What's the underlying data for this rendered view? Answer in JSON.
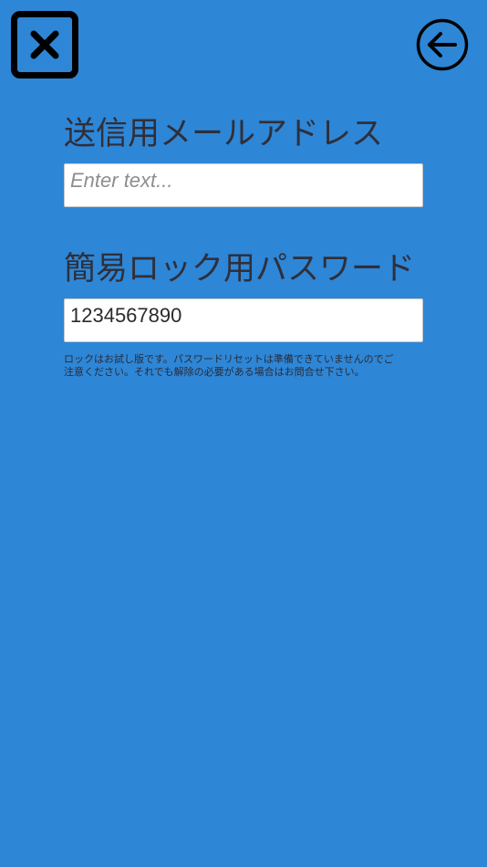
{
  "header": {
    "close_icon": "close-x-icon",
    "back_icon": "arrow-left-circle-icon"
  },
  "email_section": {
    "label": "送信用メールアドレス",
    "placeholder": "Enter text...",
    "value": ""
  },
  "password_section": {
    "label": "簡易ロック用パスワード",
    "value": "1234567890"
  },
  "note": "ロックはお試し版です。パスワードリセットは準備できていませんのでご\n注意ください。それでも解除の必要がある場合はお問合せ下さい。",
  "colors": {
    "background": "#2e86d6",
    "field_background": "#ffffff",
    "label_text": "#2f2f3a",
    "icon": "#000000"
  }
}
